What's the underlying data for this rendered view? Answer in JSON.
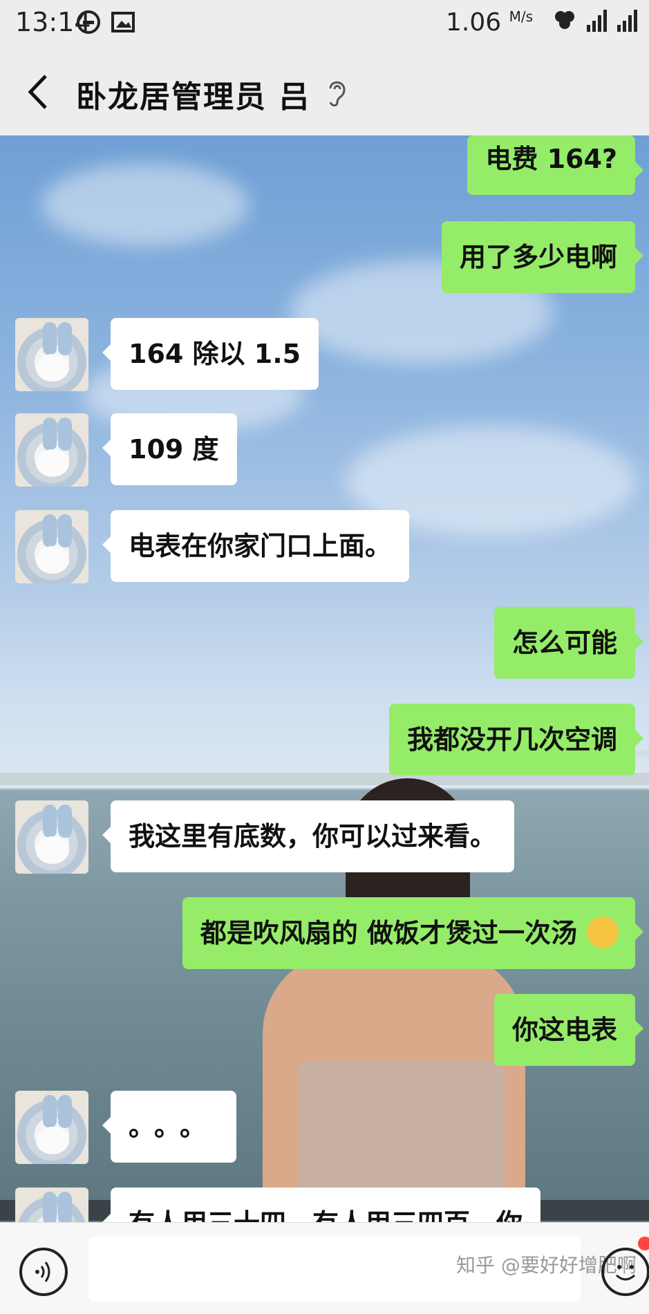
{
  "status_bar": {
    "time": "13:14",
    "speed": "1.06",
    "speed_unit": "M/s"
  },
  "header": {
    "title": "卧龙居管理员 吕"
  },
  "messages": [
    {
      "side": "out",
      "text": "电费 164?"
    },
    {
      "side": "out",
      "text": "用了多少电啊"
    },
    {
      "side": "in",
      "text": "164 除以 1.5"
    },
    {
      "side": "in",
      "text": "109 度"
    },
    {
      "side": "in",
      "text": "电表在你家门口上面。"
    },
    {
      "side": "out",
      "text": "怎么可能"
    },
    {
      "side": "out",
      "text": "我都没开几次空调"
    },
    {
      "side": "in",
      "text": "我这里有底数，你可以过来看。"
    },
    {
      "side": "out",
      "text": "都是吹风扇的 做饭才煲过一次汤"
    },
    {
      "side": "out",
      "text": "你这电表"
    },
    {
      "side": "in",
      "text": "。。。"
    },
    {
      "side": "in",
      "text": "有人用三十四，有人用三四百，你"
    }
  ],
  "input": {
    "watermark": "知乎 @要好好增肥啊"
  },
  "colors": {
    "outgoing": "#95ec69",
    "incoming": "#ffffff",
    "bar": "#ededed"
  }
}
